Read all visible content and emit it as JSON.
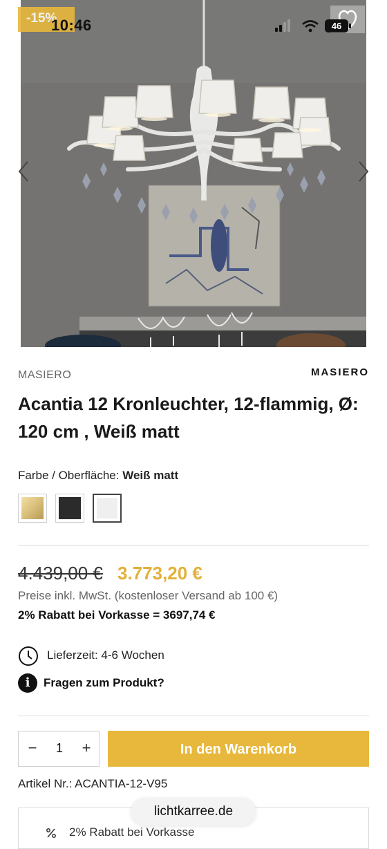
{
  "status_bar": {
    "time": "10:46",
    "battery": "46"
  },
  "gallery": {
    "discount_badge": "-15%",
    "icons": {
      "favorite": "heart-icon",
      "prev": "chevron-left-icon",
      "next": "chevron-right-icon"
    }
  },
  "product": {
    "brand": "MASIERO",
    "brand_logo": "MASIERO",
    "title": "Acantia 12 Kronleuchter, 12-flammig, Ø: 120 cm , Weiß matt",
    "color_label": "Farbe / Oberfläche:",
    "color_value": "Weiß matt",
    "swatches": [
      {
        "name": "gold",
        "color": "#d8bf7a"
      },
      {
        "name": "black",
        "color": "#2b2b2b"
      },
      {
        "name": "white-matt",
        "color": "#f0f0f0",
        "selected": true
      }
    ],
    "price_old": "4.439,00 €",
    "price_new": "3.773,20 €",
    "vat_note": "Preise inkl. MwSt. (kostenloser Versand ab 100 €)",
    "prepay_discount": "2% Rabatt bei Vorkasse = 3697,74 €",
    "delivery": "Lieferzeit: 4-6 Wochen",
    "questions": "Fragen zum Produkt?",
    "quantity": "1",
    "minus": "−",
    "plus": "+",
    "add_to_cart": "In den Warenkorb",
    "sku": "Artikel Nr.: ACANTIA-12-V95",
    "promo": "2% Rabatt bei Vorkasse"
  },
  "browser": {
    "url": "lichtkarree.de"
  },
  "colors": {
    "accent": "#e7b83c",
    "text": "#1f1f1f",
    "muted": "#666666"
  }
}
